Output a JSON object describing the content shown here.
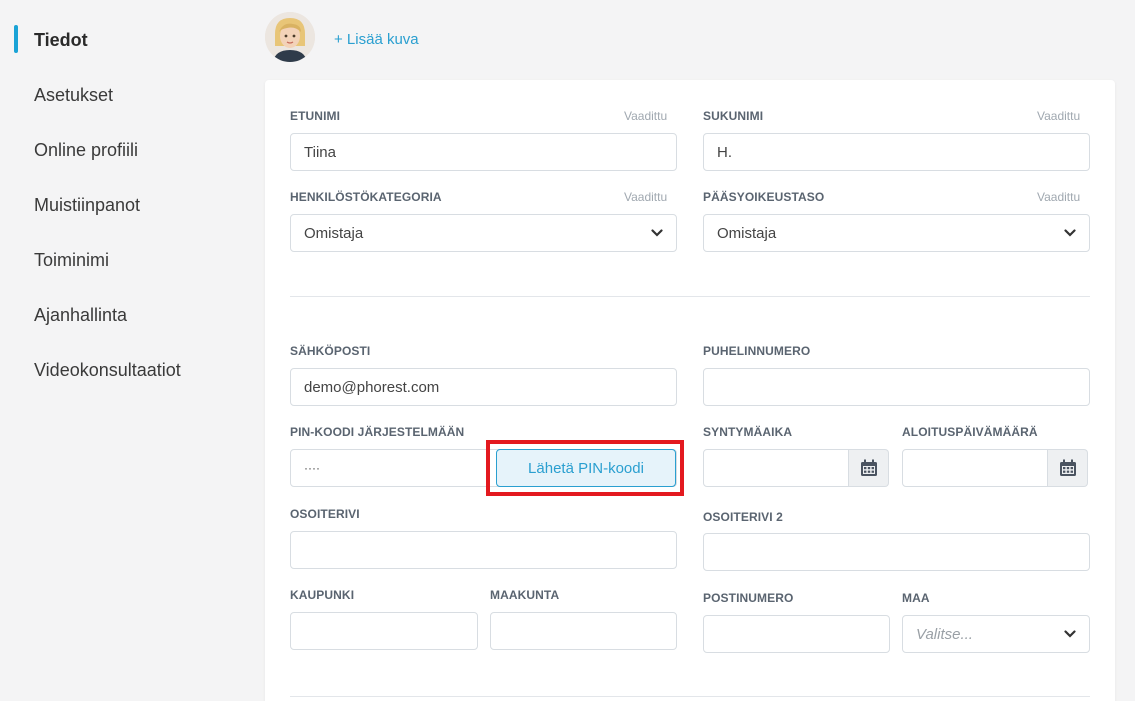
{
  "sidebar": {
    "items": [
      {
        "label": "Tiedot",
        "active": true
      },
      {
        "label": "Asetukset"
      },
      {
        "label": "Online profiili"
      },
      {
        "label": "Muistiinpanot"
      },
      {
        "label": "Toiminimi"
      },
      {
        "label": "Ajanhallinta"
      },
      {
        "label": "Videokonsultaatiot"
      }
    ]
  },
  "header": {
    "add_photo": "+ Lisää kuva"
  },
  "form": {
    "required_text": "Vaadittu",
    "first_name": {
      "label": "ETUNIMI",
      "value": "Tiina"
    },
    "last_name": {
      "label": "SUKUNIMI",
      "value": "H."
    },
    "staff_category": {
      "label": "HENKILÖSTÖKATEGORIA",
      "value": "Omistaja"
    },
    "access_level": {
      "label": "PÄÄSYOIKEUSTASO",
      "value": "Omistaja"
    },
    "email": {
      "label": "SÄHKÖPOSTI",
      "value": "demo@phorest.com"
    },
    "phone": {
      "label": "PUHELINNUMERO",
      "value": ""
    },
    "pin": {
      "label": "PIN-KOODI JÄRJESTELMÄÄN",
      "value": "····",
      "button": "Lähetä PIN-koodi"
    },
    "birthdate": {
      "label": "SYNTYMÄAIKA",
      "value": ""
    },
    "start_date": {
      "label": "ALOITUSPÄIVÄMÄÄRÄ",
      "value": ""
    },
    "address1": {
      "label": "OSOITERIVI",
      "value": ""
    },
    "address2": {
      "label": "OSOITERIVI 2",
      "value": ""
    },
    "city": {
      "label": "KAUPUNKI",
      "value": ""
    },
    "region": {
      "label": "MAAKUNTA",
      "value": ""
    },
    "postcode": {
      "label": "POSTINUMERO",
      "value": ""
    },
    "country": {
      "label": "MAA",
      "placeholder": "Valitse..."
    }
  },
  "colors": {
    "accent": "#2a9fd0",
    "highlight": "#e3191f"
  }
}
